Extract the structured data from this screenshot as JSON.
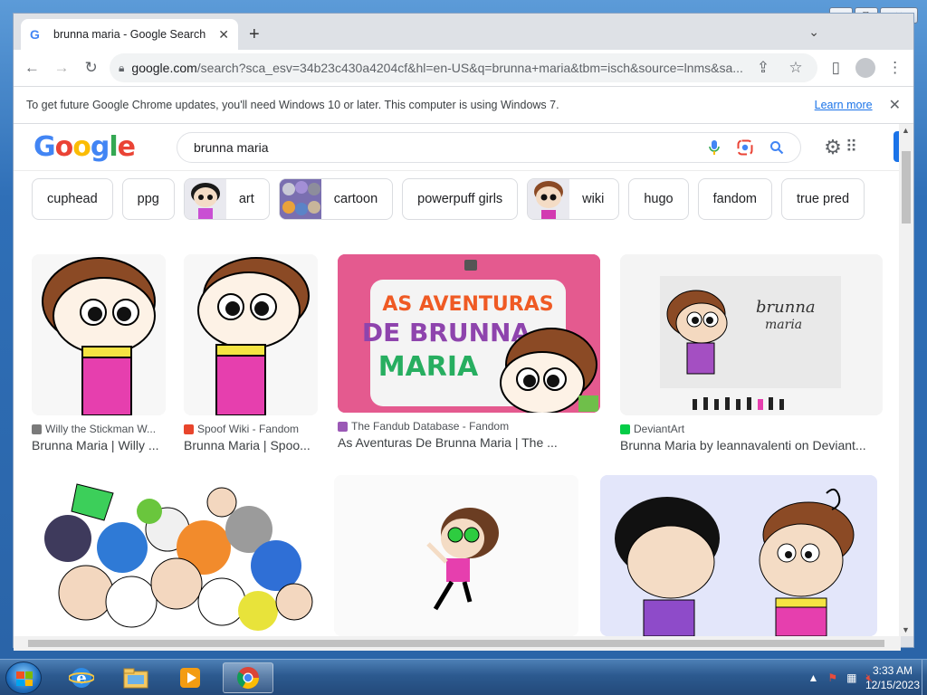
{
  "window": {
    "minimize_glyph": "▭",
    "maximize_glyph": "⧉",
    "close_glyph": "✕"
  },
  "browser": {
    "tab_title": "brunna maria - Google Search",
    "tab_close": "✕",
    "new_tab": "+",
    "tab_menu": "⌄",
    "url_host": "google.com",
    "url_path": "/search?sca_esv=34b23c430a4204cf&hl=en-US&q=brunna+maria&tbm=isch&source=lnms&sa...",
    "infobar_message": "To get future Google Chrome updates, you'll need Windows 10 or later. This computer is using Windows 7.",
    "infobar_link": "Learn more",
    "infobar_close": "✕"
  },
  "google": {
    "logo": [
      "G",
      "o",
      "o",
      "g",
      "l",
      "e"
    ],
    "query": "brunna maria",
    "chips": [
      "cuphead",
      "ppg",
      "art",
      "cartoon",
      "powerpuff girls",
      "wiki",
      "hugo",
      "fandom",
      "true pred"
    ]
  },
  "results_row1": [
    {
      "source": "Willy the Stickman W...",
      "title": "Brunna Maria | Willy ...",
      "favicon_color": "#7a7a7a"
    },
    {
      "source": "Spoof Wiki - Fandom",
      "title": "Brunna Maria | Spoo...",
      "favicon_color": "#e8452c"
    },
    {
      "source": "The Fandub Database - Fandom",
      "title": "As Aventuras De Brunna Maria | The ...",
      "favicon_color": "#9b59b6"
    },
    {
      "source": "DeviantArt",
      "title": "Brunna Maria by leannavalenti on Deviant...",
      "favicon_color": "#05cc47"
    }
  ],
  "artwork_text": {
    "banner_line1": "AS AVENTURAS",
    "banner_line2": "DE BRUNNA",
    "banner_line3": "MARIA",
    "sketch_caption_line1": "brunna",
    "sketch_caption_line2": "maria"
  },
  "taskbar": {
    "time": "3:33 AM",
    "date": "12/15/2023"
  },
  "colors": {
    "google_blue": "#4285f4",
    "google_red": "#ea4335",
    "google_yellow": "#fbbc05",
    "google_green": "#34a853",
    "link_blue": "#1a73e8"
  }
}
